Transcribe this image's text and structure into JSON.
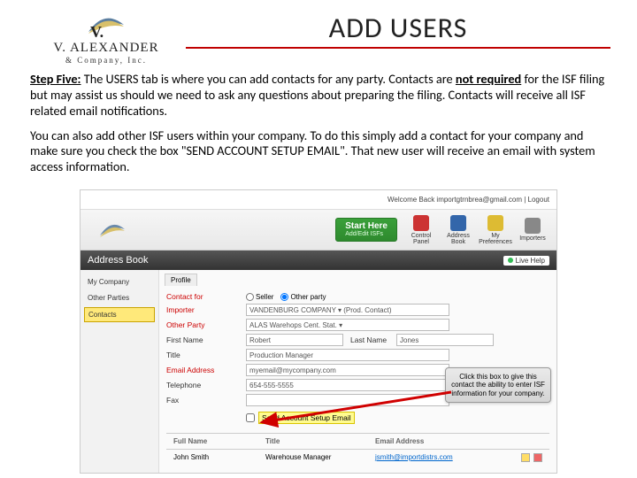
{
  "logo": {
    "name": "V. ALEXANDER",
    "subtitle": "& Company, Inc."
  },
  "title": "ADD USERS",
  "para1_a": "Step Five:",
  "para1_b": " The USERS tab is where you can add contacts for any party. Contacts are ",
  "para1_c": "not required",
  "para1_d": " for the ISF filing but may assist us should we need to ask any questions about preparing the filing.  Contacts will receive all ISF related email notifications.",
  "para2": "You can also add other ISF users within your company. To do this simply add a contact for your company and make sure you check the box \"SEND ACCOUNT SETUP EMAIL\". That new user will receive an email with system access information.",
  "shot": {
    "welcome": "Welcome Back importgtrnbrea@gmail.com | Logout",
    "startHere": "Start Here",
    "startSub": "Add/Edit ISFs",
    "nav": [
      "Control Panel",
      "Address Book",
      "My Preferences",
      "Importers"
    ],
    "section": "Address Book",
    "livehelp": "Live Help",
    "sideTabs": [
      "My Company",
      "Other Parties",
      "Contacts"
    ],
    "formTab": "Profile",
    "labels": {
      "contactFor": "Contact for",
      "importer": "Importer",
      "otherParty": "Other Party",
      "firstName": "First Name",
      "lastName": "Last Name",
      "title": "Title",
      "email": "Email Address",
      "telephone": "Telephone",
      "fax": "Fax"
    },
    "radios": {
      "seller": "Seller",
      "other": "Other party"
    },
    "values": {
      "importer": "VANDENBURG COMPANY ▾  (Prod. Contact)",
      "otherParty": "ALAS Warehops Cent. Stat. ▾",
      "firstName": "Robert",
      "lastName": "Jones",
      "title": "Production Manager",
      "email": "myemail@mycompany.com",
      "telephone": "654-555-5555",
      "fax": ""
    },
    "checkbox": "Send Account Setup Email",
    "calloutText": "Click this box to give this contact the ability to enter ISF information for your company.",
    "result": {
      "cols": [
        "Full Name",
        "Title",
        "Email Address"
      ],
      "row": [
        "John Smith",
        "Warehouse Manager",
        "jsmith@importdistrs.com"
      ]
    }
  }
}
